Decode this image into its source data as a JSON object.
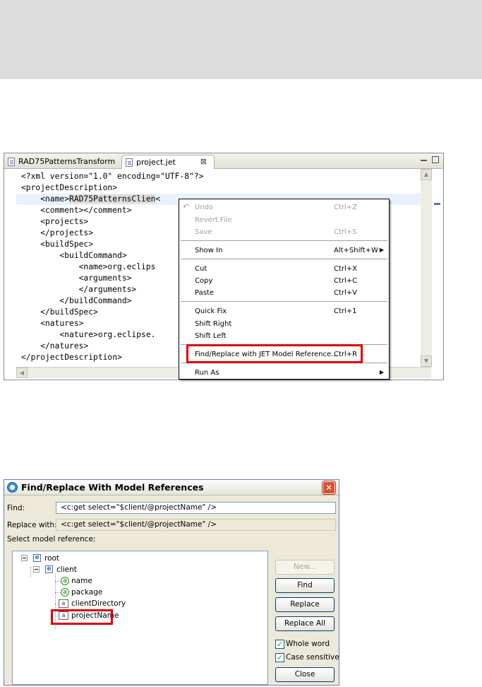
{
  "editor": {
    "tabs": [
      {
        "label": "RAD75PatternsTransform"
      },
      {
        "label": "project.jet",
        "close": "⊠"
      }
    ],
    "code_lines": [
      "<?xml version=\"1.0\" encoding=\"UTF-8\"?>",
      "<projectDescription>",
      "    <name>",
      "    <comment></comment>",
      "    <projects>",
      "    </projects>",
      "    <buildSpec>",
      "        <buildCommand>",
      "            <name>org.eclips",
      "            <arguments>",
      "            </arguments>",
      "        </buildCommand>",
      "    </buildSpec>",
      "    <natures>",
      "        <nature>org.eclipse.",
      "    </natures>",
      "</projectDescription>"
    ],
    "selected_text": "RAD75PatternsClien",
    "after_selection": "<"
  },
  "context_menu": {
    "items": [
      {
        "label": "Undo",
        "accel": "Ctrl+Z",
        "disabled": true
      },
      {
        "label": "Revert File",
        "accel": "",
        "disabled": true
      },
      {
        "label": "Save",
        "accel": "Ctrl+S",
        "disabled": true
      },
      {
        "label": "Show In",
        "accel": "Alt+Shift+W",
        "disabled": false,
        "submenu": true
      },
      {
        "label": "Cut",
        "accel": "Ctrl+X",
        "disabled": false
      },
      {
        "label": "Copy",
        "accel": "Ctrl+C",
        "disabled": false
      },
      {
        "label": "Paste",
        "accel": "Ctrl+V",
        "disabled": false
      },
      {
        "label": "Quick Fix",
        "accel": "Ctrl+1",
        "disabled": false
      },
      {
        "label": "Shift Right",
        "accel": "",
        "disabled": false
      },
      {
        "label": "Shift Left",
        "accel": "",
        "disabled": false
      },
      {
        "label": "Find/Replace with JET Model Reference...",
        "accel": "Ctrl+R",
        "disabled": false
      },
      {
        "label": "Run As",
        "accel": "",
        "disabled": false,
        "submenu": true
      }
    ],
    "submenu_arrow": "▶"
  },
  "dialog": {
    "title": "Find/Replace With Model References",
    "close_glyph": "✕",
    "find_label": "Find:",
    "find_value": "<c:get select=\"$client/@projectName\" />",
    "replace_label": "Replace with:",
    "replace_value": "<c:get select=\"$client/@projectName\" />",
    "select_label": "Select model reference:",
    "tree": {
      "root": "root",
      "client": "client",
      "name": "name",
      "package": "package",
      "clientDirectory": "clientDirectory",
      "projectName": "projectName",
      "element_glyph": "e",
      "attr_glyph": "a"
    },
    "buttons": {
      "new": "New...",
      "find": "Find",
      "replace": "Replace",
      "replace_all": "Replace All",
      "close": "Close"
    },
    "checkboxes": {
      "whole_word": "Whole word",
      "case_sensitive": "Case sensitive",
      "check_glyph": "✓"
    }
  }
}
